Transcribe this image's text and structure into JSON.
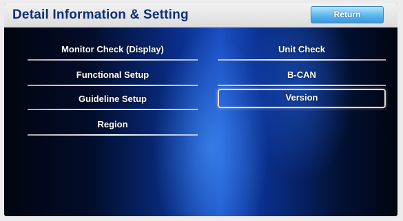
{
  "header": {
    "title": "Detail Information & Setting",
    "return_label": "Return"
  },
  "menu": {
    "left": [
      {
        "label": "Monitor Check (Display)"
      },
      {
        "label": "Functional Setup"
      },
      {
        "label": "Guideline Setup"
      },
      {
        "label": "Region"
      }
    ],
    "right": [
      {
        "label": "Unit Check"
      },
      {
        "label": "B-CAN"
      },
      {
        "label": "Version",
        "selected": true
      }
    ]
  },
  "colors": {
    "title_text": "#0c2d78",
    "return_button": "#5cb5ee",
    "screen_accent": "#1a4fc5",
    "selected_border": "#e6dccf"
  }
}
